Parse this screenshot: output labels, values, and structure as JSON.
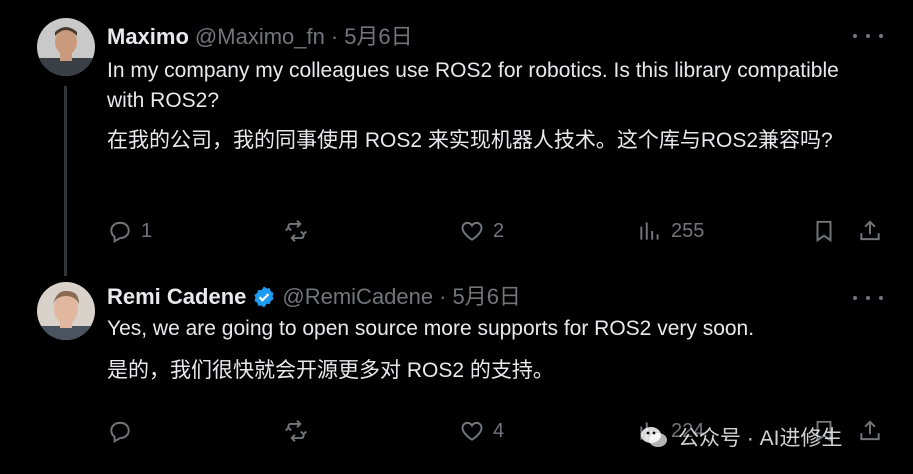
{
  "tweets": [
    {
      "author_name": "Maximo",
      "handle": "@Maximo_fn",
      "separator": "·",
      "date": "5月6日",
      "text_en": "In my company my colleagues use ROS2 for robotics. Is this library compatible with ROS2?",
      "text_zh": "在我的公司，我的同事使用 ROS2 来实现机器人技术。这个库与ROS2兼容吗?",
      "reply_count": "1",
      "like_count": "2",
      "view_count": "255"
    },
    {
      "author_name": "Remi Cadene",
      "verified": true,
      "handle": "@RemiCadene",
      "separator": "·",
      "date": "5月6日",
      "text_en": "Yes, we are going to open source more supports for ROS2 very soon.",
      "text_zh": "是的，我们很快就会开源更多对 ROS2 的支持。",
      "like_count": "4",
      "view_count": "224"
    }
  ],
  "watermark": {
    "text": "公众号 · AI进修生"
  },
  "colors": {
    "background": "#000000",
    "text": "#e7e9ea",
    "muted": "#71767b",
    "verified": "#1d9bf0",
    "thread_line": "#333639"
  },
  "icons": [
    "reply-icon",
    "retweet-icon",
    "like-icon",
    "views-icon",
    "bookmark-icon",
    "share-icon",
    "more-icon",
    "verified-badge-icon"
  ]
}
